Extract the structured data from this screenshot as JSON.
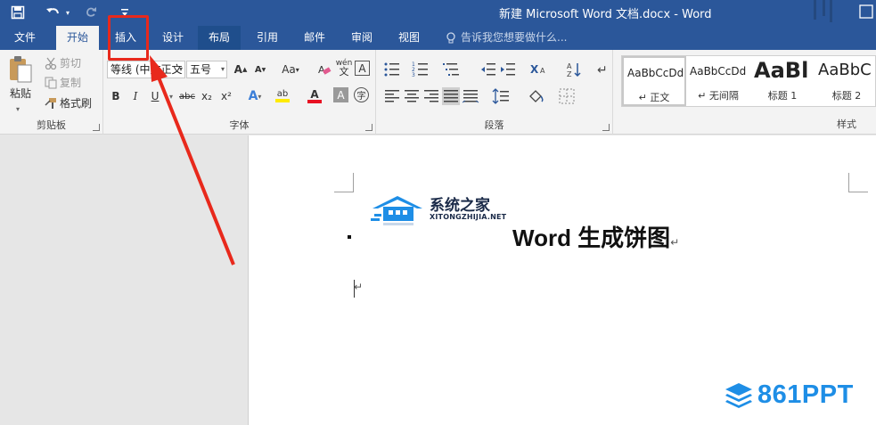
{
  "window": {
    "title": "新建 Microsoft Word 文档.docx - Word"
  },
  "quick_access": {
    "icons": [
      "save-icon",
      "undo-icon",
      "redo-icon",
      "customize-icon"
    ]
  },
  "tabs": [
    {
      "label": "文件"
    },
    {
      "label": "开始"
    },
    {
      "label": "插入"
    },
    {
      "label": "设计"
    },
    {
      "label": "布局"
    },
    {
      "label": "引用"
    },
    {
      "label": "邮件"
    },
    {
      "label": "审阅"
    },
    {
      "label": "视图"
    }
  ],
  "tell_me": {
    "placeholder": "告诉我您想要做什么..."
  },
  "ribbon": {
    "clipboard": {
      "label": "剪贴板",
      "paste": "粘贴",
      "cut": "剪切",
      "copy": "复制",
      "format_painter": "格式刷"
    },
    "font": {
      "label": "字体",
      "font_name": "等线 (中文正文",
      "font_size": "五号",
      "clear_case": "Aa",
      "bold": "B",
      "italic": "I",
      "underline": "U",
      "strike": "abc",
      "subscript": "x₂",
      "superscript": "x²",
      "grow": "A",
      "shrink": "A",
      "pinyin": "wén",
      "char_border": "A",
      "text_effect": "A",
      "highlight": "ab",
      "font_color": "A",
      "char_shading": "A",
      "enclose": "字"
    },
    "paragraph": {
      "label": "段落"
    },
    "styles": {
      "label": "样式",
      "items": [
        {
          "sample": "AaBbCcDd",
          "name": "↵ 正文"
        },
        {
          "sample": "AaBbCcDd",
          "name": "↵ 无间隔"
        },
        {
          "sample": "AaBl",
          "name": "标题 1"
        },
        {
          "sample": "AaBbC",
          "name": "标题 2"
        }
      ]
    }
  },
  "document": {
    "title_text": "Word 生成饼图",
    "return_mark": "↵",
    "cursor_mark": "↵"
  },
  "watermarks": {
    "site1_title": "系统之家",
    "site1_sub": "XITONGZHIJIA.NET",
    "site2": "861PPT"
  },
  "colors": {
    "accent": "#2b579a",
    "annotation": "#e8291c",
    "watermark_blue": "#1e8ee6"
  }
}
